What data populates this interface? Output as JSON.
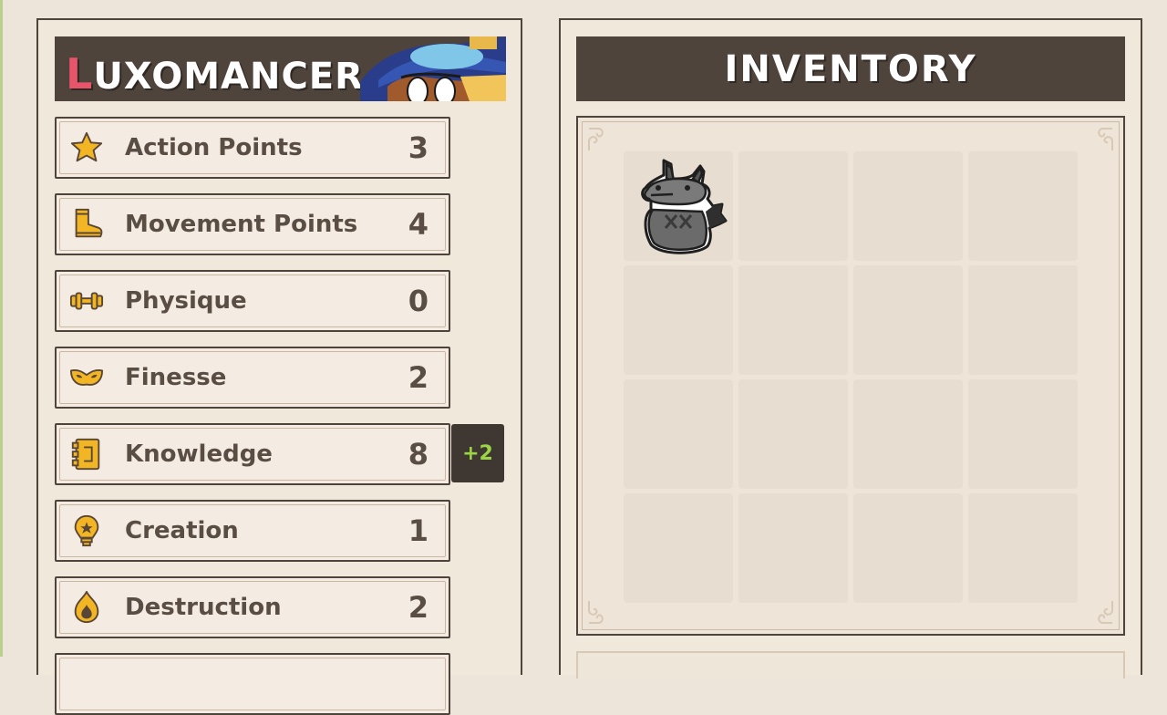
{
  "character": {
    "name_first_letter": "L",
    "name_rest": "UXOMANCER"
  },
  "stats": [
    {
      "label": "Action Points",
      "value": "3",
      "icon": "star-icon"
    },
    {
      "label": "Movement Points",
      "value": "4",
      "icon": "boot-icon"
    },
    {
      "label": "Physique",
      "value": "0",
      "icon": "dumbbell-icon"
    },
    {
      "label": "Finesse",
      "value": "2",
      "icon": "mask-icon"
    },
    {
      "label": "Knowledge",
      "value": "8",
      "icon": "book-icon",
      "bonus": "+2"
    },
    {
      "label": "Creation",
      "value": "1",
      "icon": "lightbulb-icon"
    },
    {
      "label": "Destruction",
      "value": "2",
      "icon": "flame-icon"
    }
  ],
  "inventory": {
    "title": "INVENTORY",
    "items": [
      {
        "slot": 1,
        "icon": "gargoyle-statue-icon"
      }
    ]
  },
  "colors": {
    "panel_dark": "#4f443c",
    "icon_gold": "#f2b624",
    "bonus_green": "#9bd445",
    "name_accent": "#e8556a"
  }
}
